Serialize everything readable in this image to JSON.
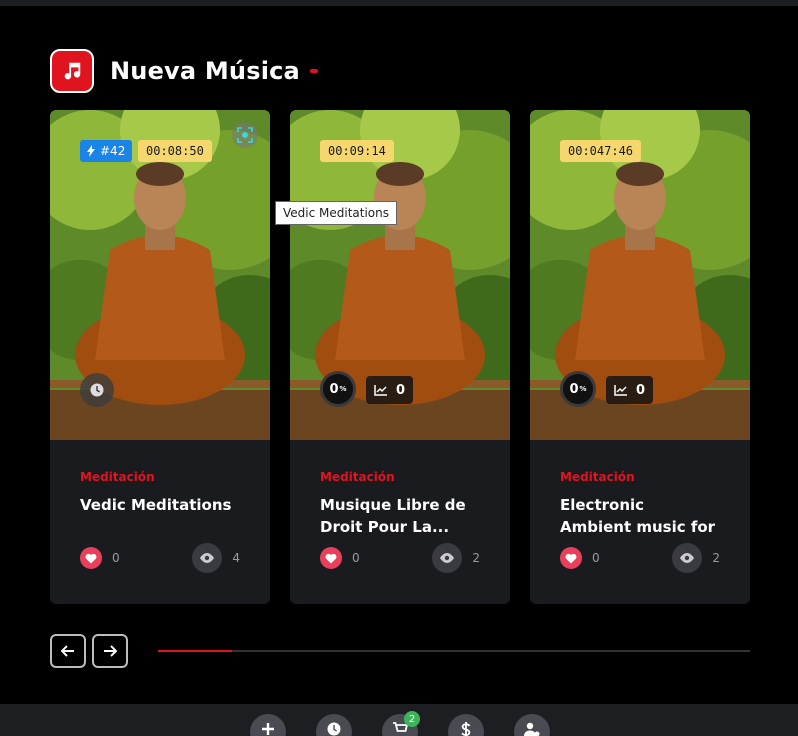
{
  "section": {
    "title": "Nueva Música",
    "icon": "music-note-icon",
    "accent": "#e0141e"
  },
  "cards": [
    {
      "rank": "#42",
      "duration": "00:08:50",
      "category": "Meditación",
      "title": "Vedic Meditations",
      "likes": "0",
      "views": "4"
    },
    {
      "duration": "00:09:14",
      "category": "Meditación",
      "title": "Musique Libre de Droit Pour La...",
      "likes": "0",
      "views": "2",
      "percent": "0",
      "percent_sign": "%",
      "trend": "0"
    },
    {
      "duration": "00:047:46",
      "category": "Meditación",
      "title": "Electronic Ambient music for relaxatio...",
      "likes": "0",
      "views": "2",
      "percent": "0",
      "percent_sign": "%",
      "trend": "0"
    }
  ],
  "tooltip": "Vedic Meditations",
  "carousel": {
    "progress": 0.125
  },
  "bottom_bar": {
    "cart_count": "2",
    "icons": [
      "plus-icon",
      "clock-icon",
      "cart-icon",
      "dollar-icon",
      "user-settings-icon"
    ]
  }
}
